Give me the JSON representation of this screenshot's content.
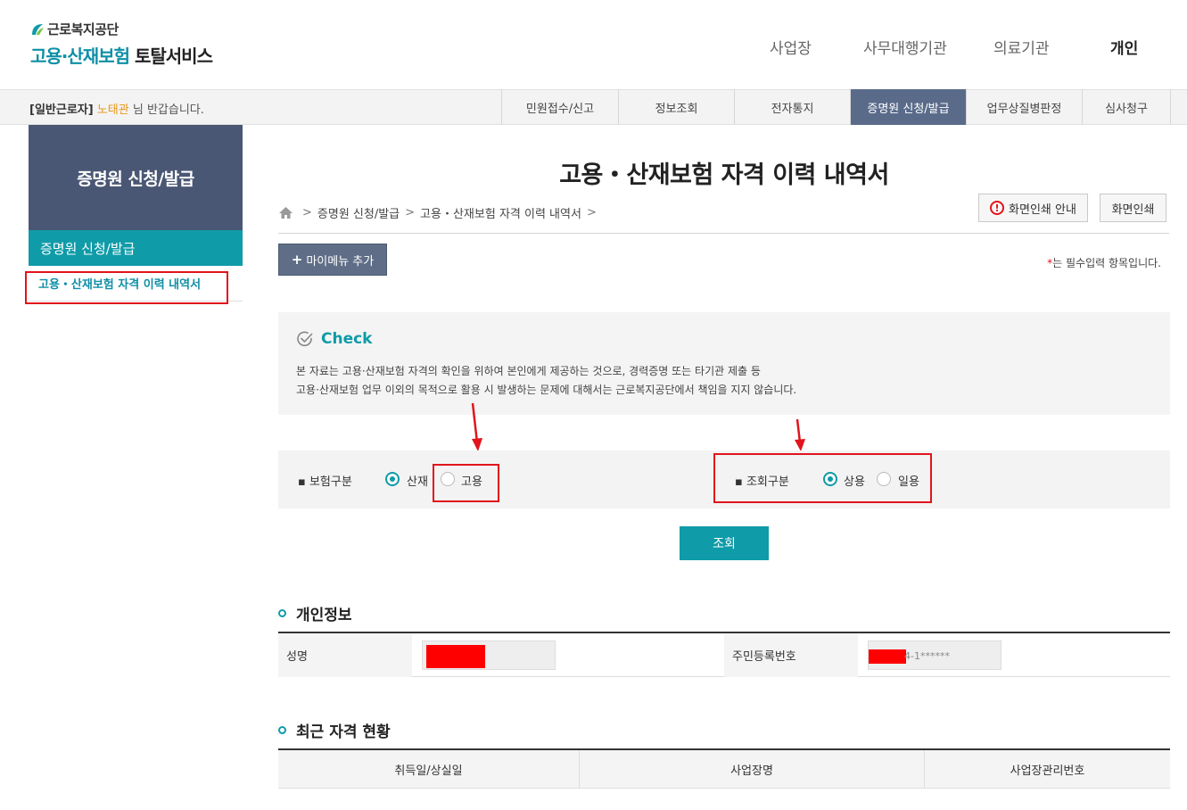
{
  "header": {
    "org_name": "근로복지공단",
    "service_name_part1": "고용·산재보험",
    "service_name_part2": "토탈서비스",
    "nav": [
      {
        "label": "사업장"
      },
      {
        "label": "사무대행기관"
      },
      {
        "label": "의료기관"
      },
      {
        "label": "개인"
      }
    ]
  },
  "subbar": {
    "role": "[일반근로자]",
    "user_name": "노태관",
    "greeting": "님 반갑습니다.",
    "tabs": [
      {
        "label": "민원접수/신고"
      },
      {
        "label": "정보조회"
      },
      {
        "label": "전자통지"
      },
      {
        "label": "증명원 신청/발급"
      },
      {
        "label": "업무상질병판정"
      },
      {
        "label": "심사청구"
      }
    ]
  },
  "sidebar": {
    "title": "증명원 신청/발급",
    "category": "증명원 신청/발급",
    "item": "고용・산재보험 자격 이력 내역서"
  },
  "main": {
    "title": "고용・산재보험 자격 이력 내역서",
    "breadcrumb": [
      "증명원 신청/발급",
      "고용・산재보험 자격 이력 내역서"
    ],
    "print_guide_label": "화면인쇄 안내",
    "print_label": "화면인쇄",
    "mymenu_label": "마이메뉴 추가",
    "required_note": "는 필수입력 항목입니다.",
    "required_mark": "*",
    "check": {
      "title": "Check",
      "line1": "본 자료는 고용·산재보험 자격의 확인을 위하여 본인에게 제공하는 것으로, 경력증명 또는 타기관 제출 등",
      "line2": "고용·산재보험 업무 이외의 목적으로 활용 시 발생하는 문제에 대해서는 근로복지공단에서 책임을 지지 않습니다."
    },
    "form": {
      "insurance_label": "보험구분",
      "insurance_options": [
        "산재",
        "고용"
      ],
      "insurance_selected": "산재",
      "query_label": "조회구분",
      "query_options": [
        "상용",
        "일용"
      ],
      "query_selected": "상용"
    },
    "search_label": "조회",
    "personal": {
      "section_title": "개인정보",
      "name_label": "성명",
      "ssn_label": "주민등록번호",
      "ssn_visible": "4-1******"
    },
    "history": {
      "section_title": "최근 자격 현황",
      "columns": [
        "취득일/상실일",
        "사업장명",
        "사업장관리번호"
      ]
    }
  },
  "colors": {
    "teal": "#0f9ba8",
    "navy": "#4a5774",
    "tab_active": "#5a6b8a",
    "annotation_red": "#e1141c",
    "username_orange": "#e8971a"
  }
}
